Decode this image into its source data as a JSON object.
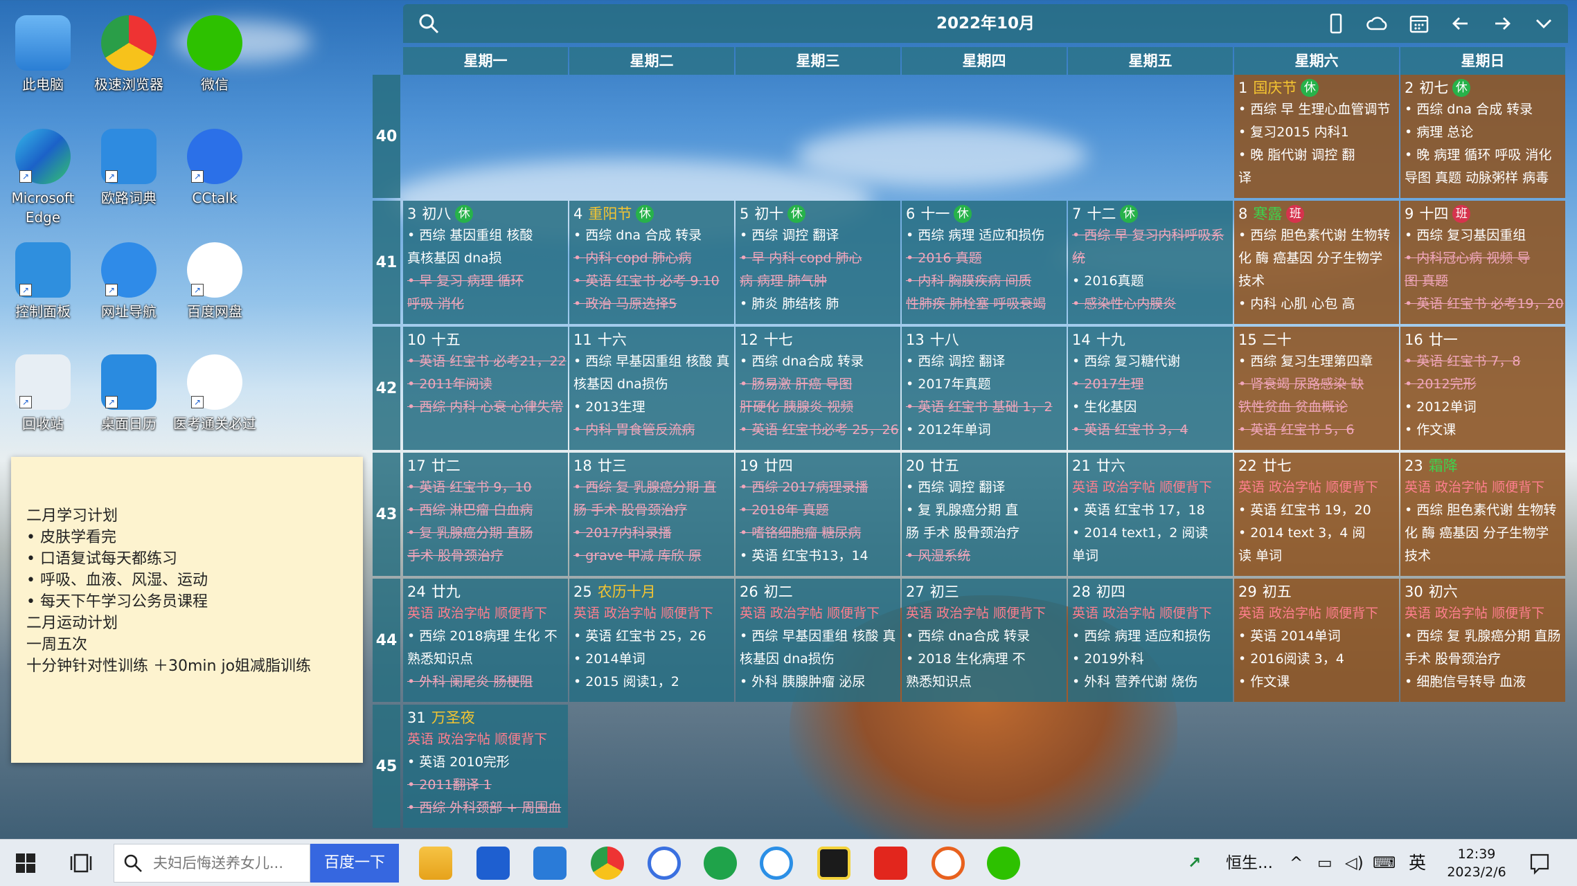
{
  "desktop": {
    "icons": [
      {
        "name": "pc-icon",
        "label": "此电脑"
      },
      {
        "name": "browser-icon",
        "label": "极速浏览器"
      },
      {
        "name": "wechat-icon",
        "label": "微信"
      },
      {
        "name": "edge-icon",
        "label": "Microsoft Edge"
      },
      {
        "name": "dictionary-icon",
        "label": "欧路词典"
      },
      {
        "name": "cctalk-icon",
        "label": "CCtalk"
      },
      {
        "name": "control-panel-icon",
        "label": "控制面板"
      },
      {
        "name": "ie-icon",
        "label": "网址导航"
      },
      {
        "name": "baidu-disk-icon",
        "label": "百度网盘"
      },
      {
        "name": "recycle-bin-icon",
        "label": "回收站"
      },
      {
        "name": "desktop-calendar-icon",
        "label": "桌面日历"
      },
      {
        "name": "exam-app-icon",
        "label": "医考通关必过"
      }
    ]
  },
  "sticky": {
    "lines": [
      "二月学习计划",
      "• 皮肤学看完",
      "• 口语复试每天都练习",
      "• 呼吸、血液、风湿、运动",
      "• 每天下午学习公务员课程",
      "",
      "二月运动计划",
      "一周五次",
      "十分钟针对性训练 ＋30min jo姐减脂训练"
    ]
  },
  "calendar": {
    "title": "2022年10月",
    "weekdays": [
      "星期一",
      "星期二",
      "星期三",
      "星期四",
      "星期五",
      "星期六",
      "星期日"
    ],
    "weeks": [
      "40",
      "41",
      "42",
      "43",
      "44",
      "45"
    ],
    "cells": [
      {
        "day": "1",
        "lunar": "",
        "fest": "国庆节",
        "festColor": "y",
        "badge": "休",
        "weekend": true,
        "lines": [
          {
            "t": "• 西综 早 生理心血管调节",
            "s": ""
          },
          {
            "t": "•          复习2015 内科1",
            "s": ""
          },
          {
            "t": "•      晚 脂代谢 调控 翻",
            "s": ""
          },
          {
            "t": "译",
            "s": ""
          }
        ]
      },
      {
        "day": "2",
        "lunar": "初七",
        "fest": "",
        "badge": "休",
        "weekend": true,
        "lines": [
          {
            "t": "• 西综 dna 合成 转录",
            "s": ""
          },
          {
            "t": "•  病理 总论",
            "s": ""
          },
          {
            "t": "•  晚 病理 循环 呼吸 消化",
            "s": ""
          },
          {
            "t": "导图 真题 动脉粥样 病毒",
            "s": ""
          }
        ]
      },
      {
        "day": "3",
        "lunar": "初八",
        "fest": "",
        "badge": "休",
        "weekend": false,
        "lines": [
          {
            "t": "• 西综    基因重组 核酸",
            "s": ""
          },
          {
            "t": "真核基因 dna损",
            "s": ""
          },
          {
            "t": "•       早 复习 病理 循环",
            "s": "done"
          },
          {
            "t": "呼吸 消化",
            "s": "done"
          }
        ]
      },
      {
        "day": "4",
        "lunar": "",
        "fest": "重阳节",
        "festColor": "y",
        "badge": "休",
        "weekend": false,
        "lines": [
          {
            "t": "• 西综 dna 合成 转录",
            "s": ""
          },
          {
            "t": "•           内科 copd 肺心病",
            "s": "done"
          },
          {
            "t": "• 英语 红宝书 必考 9.10",
            "s": "done"
          },
          {
            "t": "• 政治 马原选择5",
            "s": "done"
          }
        ]
      },
      {
        "day": "5",
        "lunar": "初十",
        "fest": "",
        "badge": "休",
        "weekend": false,
        "lines": [
          {
            "t": "• 西综 调控 翻译",
            "s": ""
          },
          {
            "t": "•        早 内科 copd 肺心",
            "s": "done"
          },
          {
            "t": "病 病理 肺气肿",
            "s": "done"
          },
          {
            "t": "•          肺炎 肺结核 肺",
            "s": ""
          }
        ]
      },
      {
        "day": "6",
        "lunar": "十一",
        "fest": "",
        "badge": "休",
        "weekend": false,
        "lines": [
          {
            "t": "• 西综 病理 适应和损伤",
            "s": ""
          },
          {
            "t": "•             2016 真题",
            "s": "done"
          },
          {
            "t": "•        内科 胸膜疾病 间质",
            "s": "done"
          },
          {
            "t": "性肺疾 肺栓塞 呼吸衰竭",
            "s": "done"
          }
        ]
      },
      {
        "day": "7",
        "lunar": "十二",
        "fest": "",
        "badge": "休",
        "weekend": false,
        "lines": [
          {
            "t": "• 西综 早 复习内科呼吸系",
            "s": "done"
          },
          {
            "t": "统",
            "s": "done"
          },
          {
            "t": "•          2016真题",
            "s": ""
          },
          {
            "t": "•        感染性心内膜炎",
            "s": "done"
          }
        ]
      },
      {
        "day": "8",
        "lunar": "",
        "fest": "寒露",
        "festColor": "g",
        "badge": "班",
        "weekend": true,
        "lines": [
          {
            "t": "• 西综 胆色素代谢 生物转",
            "s": ""
          },
          {
            "t": "化 酶 癌基因 分子生物学",
            "s": ""
          },
          {
            "t": "技术",
            "s": ""
          },
          {
            "t": "•        内科 心肌 心包 高",
            "s": ""
          }
        ]
      },
      {
        "day": "9",
        "lunar": "十四",
        "fest": "",
        "badge": "班",
        "weekend": true,
        "lines": [
          {
            "t": "• 西综 复习基因重组",
            "s": ""
          },
          {
            "t": "•            内科冠心病 视频 导",
            "s": "done"
          },
          {
            "t": "图 真题",
            "s": "done"
          },
          {
            "t": "• 英语 红宝书 必考19，20",
            "s": "done"
          }
        ]
      },
      {
        "day": "10",
        "lunar": "十五",
        "fest": "",
        "badge": "",
        "weekend": false,
        "lines": [
          {
            "t": "• 英语 红宝书 必考21，22",
            "s": "done"
          },
          {
            "t": "•        2011年阅读",
            "s": "done"
          },
          {
            "t": "• 西综 内科 心衰 心律失常",
            "s": "done"
          }
        ]
      },
      {
        "day": "11",
        "lunar": "十六",
        "fest": "",
        "badge": "",
        "weekend": false,
        "lines": [
          {
            "t": "• 西综 早基因重组 核酸 真",
            "s": ""
          },
          {
            "t": "核基因 dna损伤",
            "s": ""
          },
          {
            "t": "•          2013生理",
            "s": ""
          },
          {
            "t": "•          内科 胃食管反流病",
            "s": "done"
          }
        ]
      },
      {
        "day": "12",
        "lunar": "十七",
        "fest": "",
        "badge": "",
        "weekend": false,
        "lines": [
          {
            "t": "• 西综 dna合成 转录",
            "s": ""
          },
          {
            "t": "•         肠易激 肝癌 导图",
            "s": "done"
          },
          {
            "t": "肝硬化 胰腺炎 视频",
            "s": "done"
          },
          {
            "t": "• 英语 红宝书必考 25，26",
            "s": "done"
          }
        ]
      },
      {
        "day": "13",
        "lunar": "十八",
        "fest": "",
        "badge": "",
        "weekend": false,
        "lines": [
          {
            "t": "• 西综 调控 翻译",
            "s": ""
          },
          {
            "t": "•          2017年真题",
            "s": ""
          },
          {
            "t": "• 英语 红宝书 基础 1，2",
            "s": "done"
          },
          {
            "t": "•          2012年单词",
            "s": ""
          }
        ]
      },
      {
        "day": "14",
        "lunar": "十九",
        "fest": "",
        "badge": "",
        "weekend": false,
        "lines": [
          {
            "t": "• 西综 复习糖代谢",
            "s": ""
          },
          {
            "t": "•         2017生理",
            "s": "done"
          },
          {
            "t": "•        生化基因",
            "s": ""
          },
          {
            "t": "• 英语 红宝书 3，4",
            "s": "done"
          }
        ]
      },
      {
        "day": "15",
        "lunar": "二十",
        "fest": "",
        "badge": "",
        "weekend": true,
        "lines": [
          {
            "t": "• 西综 复习生理第四章",
            "s": ""
          },
          {
            "t": "•        肾衰竭 尿路感染 缺",
            "s": "done"
          },
          {
            "t": "铁性贫血 贫血概论",
            "s": "done"
          },
          {
            "t": "• 英语 红宝书 5，6",
            "s": "done"
          }
        ]
      },
      {
        "day": "16",
        "lunar": "廿一",
        "fest": "",
        "badge": "",
        "weekend": true,
        "lines": [
          {
            "t": "• 英语 红宝书 7，8",
            "s": "done"
          },
          {
            "t": "•       2012完形",
            "s": "done"
          },
          {
            "t": "•          2012单词",
            "s": ""
          },
          {
            "t": "•          作文课",
            "s": ""
          }
        ]
      },
      {
        "day": "17",
        "lunar": "廿二",
        "fest": "",
        "badge": "",
        "weekend": false,
        "lines": [
          {
            "t": "• 英语 红宝书 9，10",
            "s": "done"
          },
          {
            "t": "• 西综 淋巴瘤 白血病",
            "s": "done"
          },
          {
            "t": "•        复 乳腺癌分期 直肠",
            "s": "done"
          },
          {
            "t": "手术 股骨颈治疗",
            "s": "done"
          }
        ]
      },
      {
        "day": "18",
        "lunar": "廿三",
        "fest": "",
        "badge": "",
        "weekend": false,
        "lines": [
          {
            "t": "• 西综 复 乳腺癌分期 直",
            "s": "done"
          },
          {
            "t": "肠 手术 股骨颈治疗",
            "s": "done"
          },
          {
            "t": "•          2017内科录播",
            "s": "done"
          },
          {
            "t": "•         grave 甲减 库欣 原",
            "s": "done"
          }
        ]
      },
      {
        "day": "19",
        "lunar": "廿四",
        "fest": "",
        "badge": "",
        "weekend": false,
        "lines": [
          {
            "t": "• 西综 2017病理录播",
            "s": "done"
          },
          {
            "t": "•          2018年 真题",
            "s": "done"
          },
          {
            "t": "•        嗜铬细胞瘤 糖尿病",
            "s": "done"
          },
          {
            "t": "• 英语 红宝书13，14",
            "s": ""
          }
        ]
      },
      {
        "day": "20",
        "lunar": "廿五",
        "fest": "",
        "badge": "",
        "weekend": false,
        "lines": [
          {
            "t": "• 西综 调控 翻译",
            "s": ""
          },
          {
            "t": "•        复 乳腺癌分期 直",
            "s": ""
          },
          {
            "t": "肠 手术 股骨颈治疗",
            "s": ""
          },
          {
            "t": "•        风湿系统",
            "s": "done"
          }
        ]
      },
      {
        "day": "21",
        "lunar": "廿六",
        "fest": "",
        "badge": "",
        "weekend": false,
        "lines": [
          {
            "t": "英语 政治字帖 顺便背下",
            "s": "red"
          },
          {
            "t": "• 英语 红宝书 17，18",
            "s": ""
          },
          {
            "t": "•        2014 text1，2 阅读",
            "s": ""
          },
          {
            "t": "单词",
            "s": ""
          }
        ]
      },
      {
        "day": "22",
        "lunar": "廿七",
        "fest": "",
        "badge": "",
        "weekend": true,
        "lines": [
          {
            "t": "英语 政治字帖 顺便背下",
            "s": "red"
          },
          {
            "t": "• 英语 红宝书 19，20",
            "s": ""
          },
          {
            "t": "•        2014 text 3，4 阅",
            "s": ""
          },
          {
            "t": "读 单词",
            "s": ""
          }
        ]
      },
      {
        "day": "23",
        "lunar": "",
        "fest": "霜降",
        "festColor": "g",
        "badge": "",
        "weekend": true,
        "lines": [
          {
            "t": "英语 政治字帖 顺便背下",
            "s": "red"
          },
          {
            "t": "• 西综 胆色素代谢 生物转",
            "s": ""
          },
          {
            "t": "化 酶 癌基因 分子生物学",
            "s": ""
          },
          {
            "t": "技术",
            "s": ""
          }
        ]
      },
      {
        "day": "24",
        "lunar": "廿九",
        "fest": "",
        "badge": "",
        "weekend": false,
        "lines": [
          {
            "t": "英语 政治字帖 顺便背下",
            "s": "red"
          },
          {
            "t": "• 西综 2018病理 生化 不",
            "s": ""
          },
          {
            "t": "熟悉知识点",
            "s": ""
          },
          {
            "t": "•        外科 阑尾炎 肠梗阻",
            "s": "done"
          }
        ]
      },
      {
        "day": "25",
        "lunar": "",
        "fest": "农历十月",
        "festColor": "y",
        "badge": "",
        "weekend": false,
        "lines": [
          {
            "t": "英语 政治字帖 顺便背下",
            "s": "red"
          },
          {
            "t": "• 英语 红宝书 25，26",
            "s": ""
          },
          {
            "t": "•        2014单词",
            "s": ""
          },
          {
            "t": "•        2015 阅读1，2",
            "s": ""
          }
        ]
      },
      {
        "day": "26",
        "lunar": "初二",
        "fest": "",
        "badge": "",
        "weekend": false,
        "lines": [
          {
            "t": "英语 政治字帖 顺便背下",
            "s": "red"
          },
          {
            "t": "• 西综 早基因重组 核酸 真",
            "s": ""
          },
          {
            "t": "核基因 dna损伤",
            "s": ""
          },
          {
            "t": "•        外科 胰腺肿瘤 泌尿",
            "s": ""
          }
        ]
      },
      {
        "day": "27",
        "lunar": "初三",
        "fest": "",
        "badge": "",
        "weekend": false,
        "lines": [
          {
            "t": "英语 政治字帖 顺便背下",
            "s": "red"
          },
          {
            "t": "• 西综 dna合成 转录",
            "s": ""
          },
          {
            "t": "•        2018 生化病理 不",
            "s": ""
          },
          {
            "t": "熟悉知识点",
            "s": ""
          }
        ]
      },
      {
        "day": "28",
        "lunar": "初四",
        "fest": "",
        "badge": "",
        "weekend": false,
        "lines": [
          {
            "t": "英语 政治字帖 顺便背下",
            "s": "red"
          },
          {
            "t": "• 西综 病理 适应和损伤",
            "s": ""
          },
          {
            "t": "•        2019外科",
            "s": ""
          },
          {
            "t": "•        外科 营养代谢 烧伤",
            "s": ""
          }
        ]
      },
      {
        "day": "29",
        "lunar": "初五",
        "fest": "",
        "badge": "",
        "weekend": true,
        "lines": [
          {
            "t": "英语 政治字帖 顺便背下",
            "s": "red"
          },
          {
            "t": "• 英语 2014单词",
            "s": ""
          },
          {
            "t": "•        2016阅读 3，4",
            "s": ""
          },
          {
            "t": "•        作文课",
            "s": ""
          }
        ]
      },
      {
        "day": "30",
        "lunar": "初六",
        "fest": "",
        "badge": "",
        "weekend": true,
        "lines": [
          {
            "t": "英语 政治字帖 顺便背下",
            "s": "red"
          },
          {
            "t": "• 西综 复 乳腺癌分期 直肠",
            "s": ""
          },
          {
            "t": "手术 股骨颈治疗",
            "s": ""
          },
          {
            "t": "•        细胞信号转导 血液",
            "s": ""
          }
        ]
      },
      {
        "day": "31",
        "lunar": "",
        "fest": "万圣夜",
        "festColor": "y",
        "badge": "",
        "weekend": false,
        "lines": [
          {
            "t": "英语 政治字帖 顺便背下",
            "s": "red"
          },
          {
            "t": "• 英语 2010完形",
            "s": ""
          },
          {
            "t": "• 2011翻译 1",
            "s": "done"
          },
          {
            "t": "• 西综 外科颈部 + 周围血",
            "s": "done"
          }
        ]
      }
    ]
  },
  "taskbar": {
    "search_placeholder": "夫妇后悔送养女儿...",
    "search_button": "百度一下",
    "tray_app": "恒生...",
    "ime": "英",
    "time": "12:39",
    "date": "2023/2/6"
  },
  "colors": {
    "cell": "#26788f",
    "weekend": "#8e5626",
    "rest_badge": "#27b24a",
    "work_badge": "#d6334d"
  }
}
